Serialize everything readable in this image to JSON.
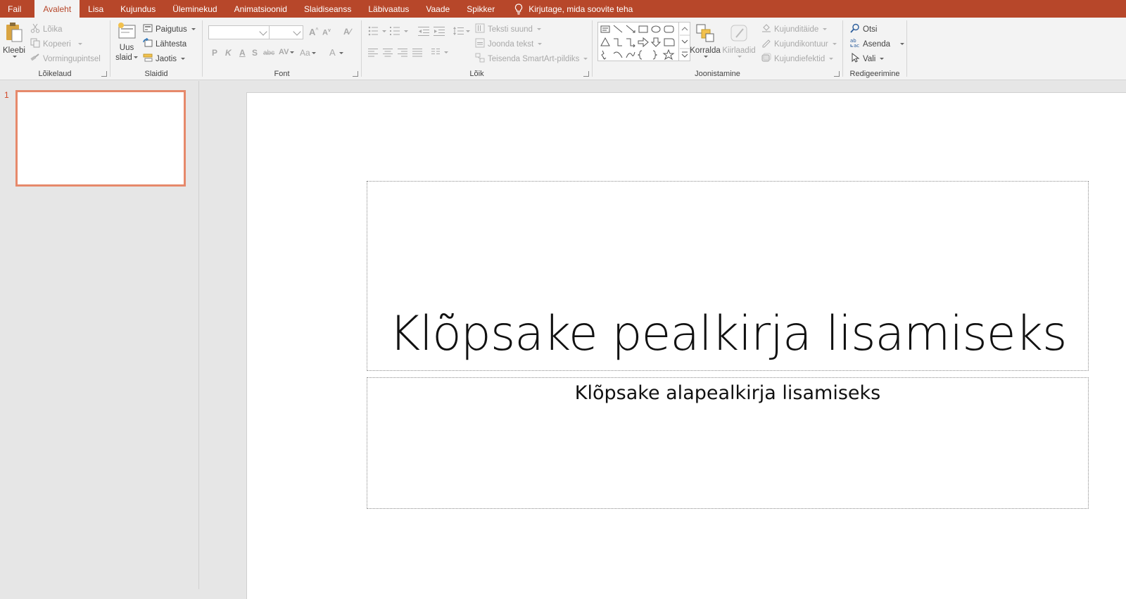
{
  "tabs": [
    {
      "label": "Fail"
    },
    {
      "label": "Avaleht",
      "active": true
    },
    {
      "label": "Lisa"
    },
    {
      "label": "Kujundus"
    },
    {
      "label": "Üleminekud"
    },
    {
      "label": "Animatsioonid"
    },
    {
      "label": "Slaidiseanss"
    },
    {
      "label": "Läbivaatus"
    },
    {
      "label": "Vaade"
    },
    {
      "label": "Spikker"
    }
  ],
  "tell_me": "Kirjutage, mida soovite teha",
  "ribbon": {
    "clipboard": {
      "label": "Lõikelaud",
      "paste": "Kleebi",
      "cut": "Lõika",
      "copy": "Kopeeri",
      "format_painter": "Vormingupintsel"
    },
    "slides": {
      "label": "Slaidid",
      "new_slide_1": "Uus",
      "new_slide_2": "slaid",
      "layout": "Paigutus",
      "reset": "Lähtesta",
      "section": "Jaotis"
    },
    "font": {
      "label": "Font",
      "bold": "P",
      "italic": "K",
      "underline": "A",
      "shadow": "S",
      "strike": "abc",
      "spacing": "AV",
      "case": "Aa",
      "color": "A"
    },
    "paragraph": {
      "label": "Lõik",
      "text_direction": "Teksti suund",
      "align_text": "Joonda tekst",
      "smartart": "Teisenda SmartArt-pildiks"
    },
    "drawing": {
      "label": "Joonistamine",
      "arrange": "Korralda",
      "quick_styles": "Kiirlaadid",
      "shape_fill": "Kujunditäide",
      "shape_outline": "Kujundikontuur",
      "shape_effects": "Kujundiefektid"
    },
    "editing": {
      "label": "Redigeerimine",
      "find": "Otsi",
      "replace": "Asenda",
      "select": "Vali"
    }
  },
  "thumbnails": [
    {
      "number": "1"
    }
  ],
  "slide": {
    "title_placeholder": "Klõpsake pealkirja lisamiseks",
    "subtitle_placeholder": "Klõpsake alapealkirja lisamiseks"
  },
  "colors": {
    "accent": "#b7472a",
    "selection": "#e6896b"
  }
}
